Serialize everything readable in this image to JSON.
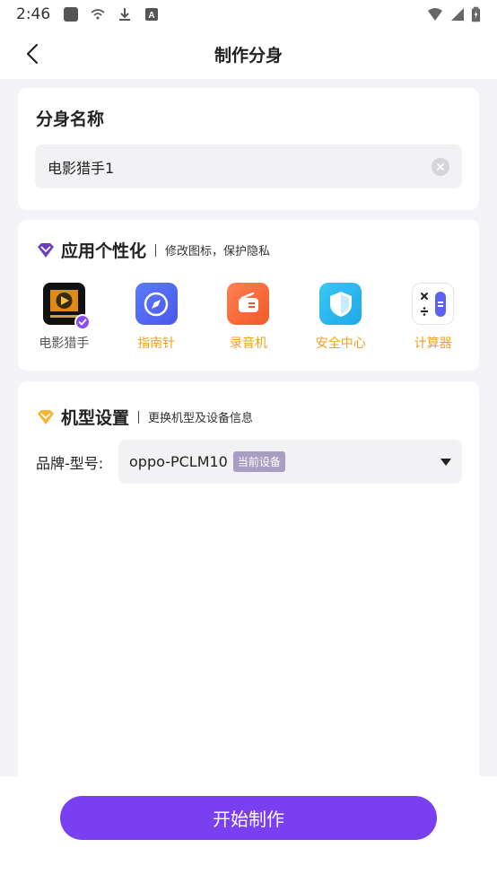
{
  "status_bar": {
    "time": "2:46",
    "icons": [
      "square-app-icon",
      "wifi-question-icon",
      "download-icon",
      "a-box-icon",
      "wifi-icon",
      "signal-icon",
      "battery-icon"
    ]
  },
  "header": {
    "title": "制作分身",
    "back_icon": "chevron-left-icon"
  },
  "clone_name": {
    "section_title": "分身名称",
    "input_value": "电影猎手1"
  },
  "personalize": {
    "title": "应用个性化",
    "subtitle": "修改图标，保护隐私",
    "apps": [
      {
        "label": "电影猎手",
        "icon": "movie-app-icon",
        "selected": true
      },
      {
        "label": "指南针",
        "icon": "compass-icon",
        "selected": false
      },
      {
        "label": "录音机",
        "icon": "recorder-icon",
        "selected": false
      },
      {
        "label": "安全中心",
        "icon": "shield-icon",
        "selected": false
      },
      {
        "label": "计算器",
        "icon": "calculator-icon",
        "selected": false
      }
    ],
    "colors": {
      "selected": "#555555",
      "alt": "#f0a020",
      "accent": "#8a4bf5"
    }
  },
  "device": {
    "title": "机型设置",
    "subtitle": "更换机型及设备信息",
    "brand_label": "品牌-型号:",
    "selected_model": "oppo-PCLM10",
    "badge": "当前设备"
  },
  "footer": {
    "primary_button": "开始制作",
    "accent_color": "#7b3ff2"
  }
}
